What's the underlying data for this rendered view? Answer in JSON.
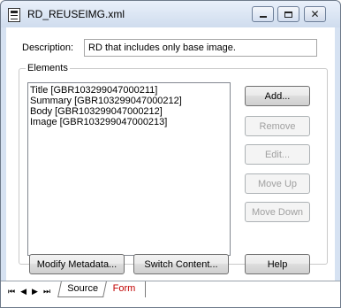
{
  "window": {
    "title": "RD_REUSEIMG.xml",
    "icon": "document-form-icon",
    "controls": [
      "minimize-icon",
      "maximize-icon",
      "close-icon"
    ]
  },
  "description": {
    "label": "Description:",
    "value": "RD that includes only base image."
  },
  "elements": {
    "group_label": "Elements",
    "items": [
      "Title [GBR103299047000211]",
      "Summary [GBR103299047000212]",
      "Body [GBR103299047000212]",
      "Image [GBR103299047000213]"
    ]
  },
  "side_buttons": {
    "add": "Add...",
    "remove": "Remove",
    "edit": "Edit...",
    "move_up": "Move Up",
    "move_down": "Move Down"
  },
  "bottom_buttons": {
    "modify_metadata": "Modify Metadata...",
    "switch_content": "Switch Content...",
    "help": "Help"
  },
  "tabs": {
    "source": "Source",
    "form": "Form",
    "active": "Form",
    "active_color": "#c00000"
  }
}
